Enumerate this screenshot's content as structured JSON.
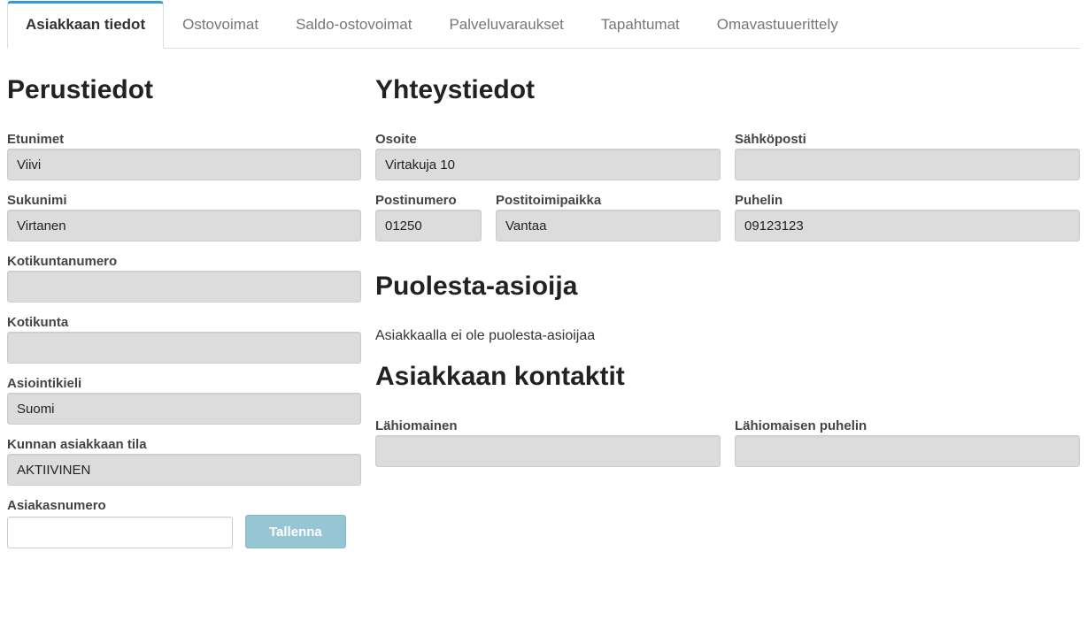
{
  "tabs": [
    {
      "label": "Asiakkaan tiedot",
      "active": true
    },
    {
      "label": "Ostovoimat",
      "active": false
    },
    {
      "label": "Saldo-ostovoimat",
      "active": false
    },
    {
      "label": "Palveluvaraukset",
      "active": false
    },
    {
      "label": "Tapahtumat",
      "active": false
    },
    {
      "label": "Omavastuuerittely",
      "active": false
    }
  ],
  "sections": {
    "perustiedot": {
      "heading": "Perustiedot",
      "etunimet": {
        "label": "Etunimet",
        "value": "Viivi"
      },
      "sukunimi": {
        "label": "Sukunimi",
        "value": "Virtanen"
      },
      "kotikuntanumero": {
        "label": "Kotikuntanumero",
        "value": ""
      },
      "kotikunta": {
        "label": "Kotikunta",
        "value": ""
      },
      "asiointikieli": {
        "label": "Asiointikieli",
        "value": "Suomi"
      },
      "kunnan_tila": {
        "label": "Kunnan asiakkaan tila",
        "value": "AKTIIVINEN"
      },
      "asiakasnumero": {
        "label": "Asiakasnumero",
        "value": ""
      },
      "tallenna": "Tallenna"
    },
    "yhteystiedot": {
      "heading": "Yhteystiedot",
      "osoite": {
        "label": "Osoite",
        "value": "Virtakuja 10"
      },
      "sahkoposti": {
        "label": "Sähköposti",
        "value": ""
      },
      "postinumero": {
        "label": "Postinumero",
        "value": "01250"
      },
      "postitoimipaikka": {
        "label": "Postitoimipaikka",
        "value": "Vantaa"
      },
      "puhelin": {
        "label": "Puhelin",
        "value": "09123123"
      }
    },
    "puolesta": {
      "heading": "Puolesta-asioija",
      "info": "Asiakkaalla ei ole puolesta-asioijaa"
    },
    "kontaktit": {
      "heading": "Asiakkaan kontaktit",
      "lahiomainen": {
        "label": "Lähiomainen",
        "value": ""
      },
      "lahiomaisen_puhelin": {
        "label": "Lähiomaisen puhelin",
        "value": ""
      }
    }
  }
}
